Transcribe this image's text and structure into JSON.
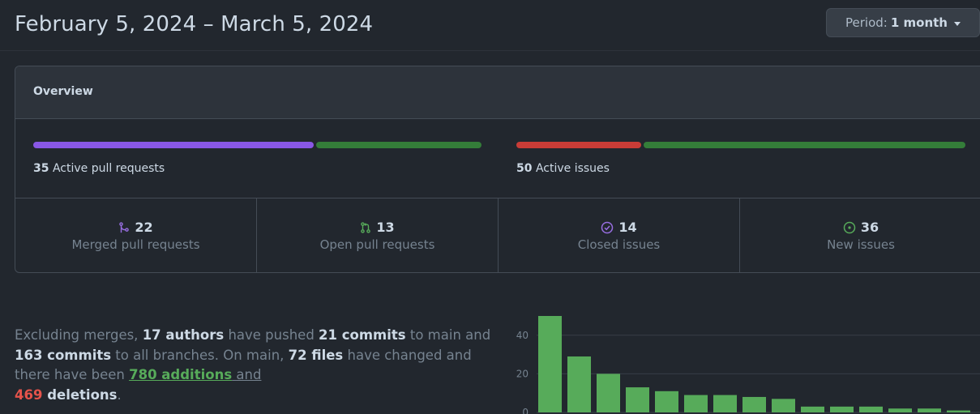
{
  "header": {
    "title": "February 5, 2024 – March 5, 2024",
    "period_prefix": "Period:",
    "period_value": "1 month"
  },
  "overview": {
    "title": "Overview",
    "pull_requests_bar": {
      "count": "35",
      "label": "Active pull requests",
      "merged_fraction": 0.629,
      "colors": [
        "#8957e5",
        "#347d39"
      ]
    },
    "issues_bar": {
      "count": "50",
      "label": "Active issues",
      "closed_fraction": 0.28,
      "colors": [
        "#c93c37",
        "#347d39"
      ]
    },
    "stats": [
      {
        "icon": "merged-pr-icon",
        "value": "22",
        "label": "Merged pull requests",
        "color": "#986ee2"
      },
      {
        "icon": "open-pr-icon",
        "value": "13",
        "label": "Open pull requests",
        "color": "#57ab5a"
      },
      {
        "icon": "closed-issue-icon",
        "value": "14",
        "label": "Closed issues",
        "color": "#986ee2"
      },
      {
        "icon": "new-issue-icon",
        "value": "36",
        "label": "New issues",
        "color": "#57ab5a"
      }
    ]
  },
  "summary": {
    "t1": "Excluding merges, ",
    "authors": "17 authors",
    "t2": " have pushed ",
    "commits_main": "21 commits",
    "t3": " to main and ",
    "commits_all": "163 commits",
    "t4": " to all branches. On main, ",
    "files": "72 files",
    "t5": " have changed and there have been ",
    "additions": "780 additions",
    "t6": " and",
    "deletions": "469",
    "deletions_word": " deletions",
    "t7": "."
  },
  "chart_data": {
    "type": "bar",
    "values": [
      50,
      29,
      20,
      13,
      11,
      9,
      9,
      8,
      7,
      3,
      3,
      3,
      2,
      2,
      1
    ],
    "yticks": [
      "40",
      "20",
      "0"
    ],
    "ylim": [
      0,
      55
    ],
    "color": "#57ab5a"
  }
}
